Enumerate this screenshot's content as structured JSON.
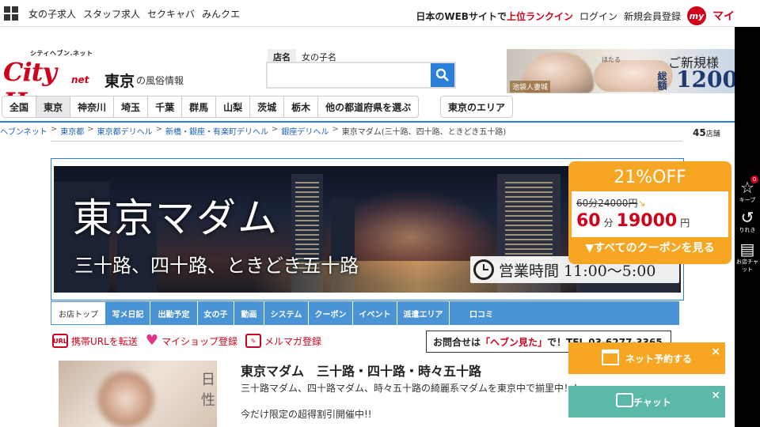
{
  "topbar": {
    "links": [
      "女の子求人",
      "スタッフ求人",
      "セクキャバ",
      "みんクエ"
    ],
    "rank_text_pre": "日本のWEBサイトで",
    "rank_text_hl": "上位ランクイン",
    "login": "ログイン",
    "register": "新規会員登録",
    "my_badge": "my",
    "my_rest": "マイ"
  },
  "logo": {
    "small": "シティヘブン.ネット",
    "main": "City Heaven",
    "net": "net"
  },
  "region": {
    "name": "東京",
    "suffix": "の風俗情報"
  },
  "search": {
    "tabs": [
      "店名",
      "女の子名"
    ],
    "placeholder": ""
  },
  "ad": {
    "tag": "池袋人妻城",
    "mini": "ほたる",
    "line1": "ご新規様",
    "line2": "1200",
    "side": "総額"
  },
  "prefectures": [
    "全国",
    "東京",
    "神奈川",
    "埼玉",
    "千葉",
    "群馬",
    "山梨",
    "茨城",
    "栃木",
    "他の都道府県を選ぶ"
  ],
  "area_button": "東京のエリア",
  "breadcrumb": [
    {
      "label": "ヘブンネット",
      "link": true
    },
    {
      "label": "東京都",
      "link": true
    },
    {
      "label": "東京都デリヘル",
      "link": true
    },
    {
      "label": "新橋・銀座・有楽町デリヘル",
      "link": true
    },
    {
      "label": "銀座デリヘル",
      "link": true
    },
    {
      "label": "東京マダム(三十路、四十路、ときどき五十路)",
      "link": false
    }
  ],
  "shop_count": {
    "value": "45",
    "unit": "店舗"
  },
  "hero": {
    "title": "東京マダム",
    "subtitle": "三十路、四十路、ときどき五十路",
    "hours": "営業時間 11:00〜5:00"
  },
  "shop_tabs": [
    "お店トップ",
    "写メ日記",
    "出勤予定",
    "女の子",
    "動画",
    "システム",
    "クーポン",
    "イベント",
    "派遣エリア",
    "口コミ"
  ],
  "actions": {
    "url": "携帯URLを転送",
    "myshop": "マイショップ登録",
    "mailmag": "メルマガ登録",
    "url_icon": "URL"
  },
  "contact": {
    "pre": "お問合せは",
    "hl": "「ヘブン見た」",
    "post": "で！TEL 03-6277-3365"
  },
  "shop": {
    "name": "東京マダム　三十路・四十路・時々五十路",
    "desc": "三十路マダム、四十路マダム、時々五十路の綺麗系マダムを東京中で揃里中！！",
    "promo": "今だけ限定の超得割引開催中!!",
    "photo_side": "日\n性"
  },
  "coupon": {
    "title": "21%OFF",
    "original": "60分24000円",
    "minutes": "60",
    "min_unit": "分",
    "price": "19000",
    "yen": "円",
    "link": "▼すべてのクーポンを見る"
  },
  "rail": {
    "keep": "キープ",
    "keep_count": "0",
    "history": "りれき",
    "chat": "お店チャット"
  },
  "float": {
    "book": "ネット予約する",
    "chat": "チャット",
    "close": "×"
  }
}
